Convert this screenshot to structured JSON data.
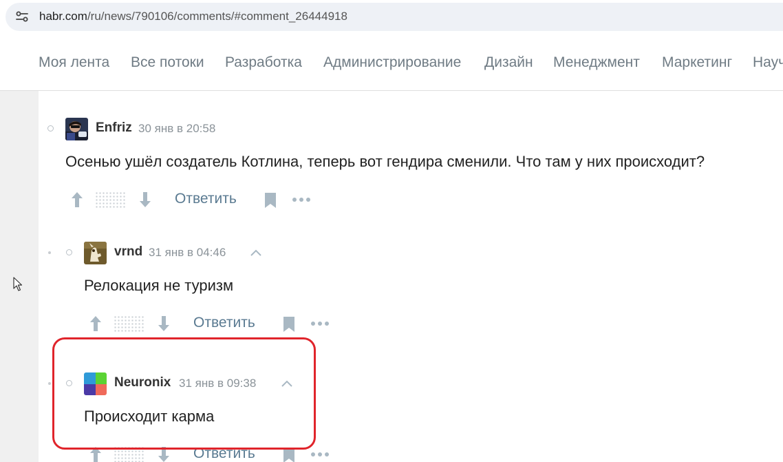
{
  "browser": {
    "url_host": "habr.com",
    "url_path": "/ru/news/790106/comments/#comment_26444918"
  },
  "nav": {
    "items": [
      "Моя лента",
      "Все потоки",
      "Разработка",
      "Администрирование",
      "Дизайн",
      "Менеджмент",
      "Маркетинг",
      "Науч"
    ]
  },
  "comments": [
    {
      "author": "Enfriz",
      "time": "30 янв в 20:58",
      "text": "Осенью ушёл создатель Котлина, теперь вот гендира сменили. Что там у них происходит?",
      "reply_label": "Ответить"
    },
    {
      "author": "vrnd",
      "time": "31 янв в 04:46",
      "text": "Релокация не туризм",
      "reply_label": "Ответить"
    },
    {
      "author": "Neuronix",
      "time": "31 янв в 09:38",
      "text": "Происходит карма",
      "reply_label": "Ответить"
    }
  ],
  "colors": {
    "highlight": "#e0242b",
    "reply_link": "#5a7a91",
    "neuronix_avatar": [
      "#5bd334",
      "#2f9ad8",
      "#4b3aa6",
      "#f06a5a"
    ]
  }
}
